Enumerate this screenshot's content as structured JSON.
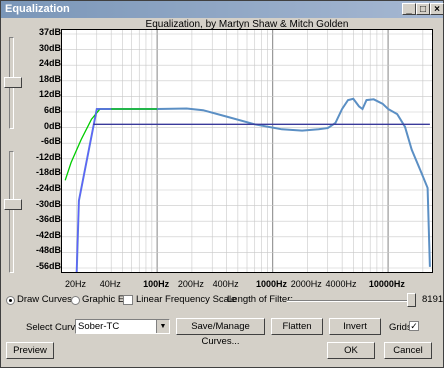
{
  "window": {
    "title": "Equalization",
    "min_icon": "_",
    "max_icon": "□",
    "close_icon": "×"
  },
  "chart_title": "Equalization, by Martyn Shaw & Mitch Golden",
  "chart_data": {
    "type": "line",
    "title": "Equalization, by Martyn Shaw & Mitch Golden",
    "y_tick_labels": [
      "37dB",
      "30dB",
      "24dB",
      "18dB",
      "12dB",
      "6dB",
      "0dB",
      "-6dB",
      "-12dB",
      "-18dB",
      "-24dB",
      "-30dB",
      "-36dB",
      "-42dB",
      "-48dB",
      "-56dB"
    ],
    "x_tick_labels": [
      "20Hz",
      "40Hz",
      "100Hz",
      "200Hz",
      "400Hz",
      "1000Hz",
      "2000Hz",
      "4000Hz",
      "10000Hz"
    ],
    "x_scale": "log",
    "grid": true,
    "ylim": [
      -58,
      37
    ],
    "xlim": [
      15,
      24000
    ],
    "series": [
      {
        "color": "#5b8fc4",
        "points": [
          [
            20,
            -62
          ],
          [
            21,
            -30
          ],
          [
            30,
            6
          ],
          [
            50,
            6
          ],
          [
            100,
            6
          ],
          [
            180,
            6.2
          ],
          [
            250,
            5.5
          ],
          [
            400,
            3
          ],
          [
            700,
            0
          ],
          [
            1200,
            -2
          ],
          [
            1800,
            -2.5
          ],
          [
            2500,
            -2
          ],
          [
            3000,
            -1.5
          ],
          [
            3500,
            0.5
          ],
          [
            4000,
            6
          ],
          [
            4500,
            9.5
          ],
          [
            5000,
            10
          ],
          [
            5600,
            7
          ],
          [
            6000,
            6
          ],
          [
            6500,
            9.5
          ],
          [
            7500,
            9.8
          ],
          [
            9000,
            8
          ],
          [
            10000,
            6
          ],
          [
            12000,
            4
          ],
          [
            14000,
            -1
          ],
          [
            16000,
            -10
          ],
          [
            19000,
            -18
          ],
          [
            22000,
            -25
          ],
          [
            23000,
            -56
          ]
        ]
      },
      {
        "color": "#00cc00",
        "points": [
          [
            16,
            -22
          ],
          [
            18,
            -15
          ],
          [
            22,
            -6
          ],
          [
            27,
            2
          ],
          [
            32,
            6
          ],
          [
            40,
            6
          ],
          [
            100,
            6
          ]
        ]
      },
      {
        "color": "#6060ff",
        "points": [
          [
            20,
            -60
          ],
          [
            21,
            -30
          ],
          [
            30,
            6
          ],
          [
            40,
            6
          ]
        ]
      },
      {
        "color": "#3a3a9a",
        "points": [
          [
            28,
            0
          ],
          [
            23000,
            0
          ]
        ]
      }
    ]
  },
  "controls": {
    "draw_curves": "Draw Curves",
    "graphic_eq": "Graphic EQ",
    "linear_freq": "Linear Frequency Scale",
    "length_label": "Length of Filter:",
    "length_value": "8191",
    "select_curve_label": "Select Curve:",
    "select_curve_value": "Sober-TC",
    "save_manage": "Save/Manage Curves...",
    "flatten": "Flatten",
    "invert": "Invert",
    "grids": "Grids",
    "grids_mark": "✓",
    "preview": "Preview",
    "ok": "OK",
    "cancel": "Cancel"
  }
}
